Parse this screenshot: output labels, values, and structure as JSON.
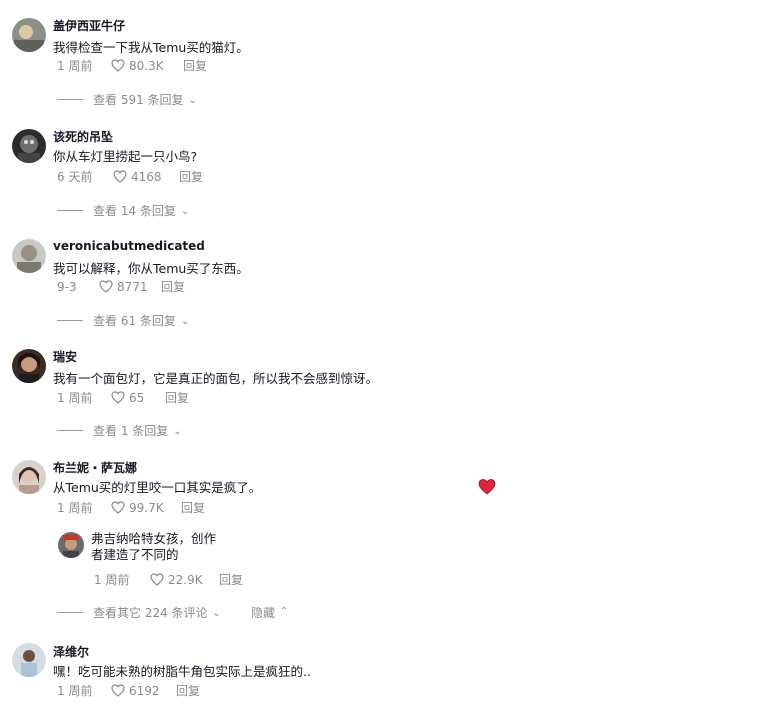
{
  "comments": [
    {
      "username": "盖伊西亚牛仔",
      "text": "我得检查一下我从Temu买的猫灯。",
      "time": "1 周前",
      "likes": "80.3K",
      "reply_label": "回复",
      "view_replies": "查看 591 条回复"
    },
    {
      "username": "该死的吊坠",
      "text": "你从车灯里捞起一只小鸟?",
      "time": "6 天前",
      "likes": "4168",
      "reply_label": "回复",
      "view_replies": "查看 14 条回复"
    },
    {
      "username": "veronicabutmedicated",
      "text": "我可以解释，你从Temu买了东西。",
      "time": "9-3",
      "likes": "8771",
      "reply_label": "回复",
      "view_replies": "查看 61 条回复"
    },
    {
      "username": "瑞安",
      "text": "我有一个面包灯，它是真正的面包，所以我不会感到惊讶。",
      "time": "1 周前",
      "likes": "65",
      "reply_label": "回复",
      "view_replies": "查看 1 条回复"
    },
    {
      "username": "布兰妮・萨瓦娜",
      "text": "从Temu买的灯里咬一口其实是疯了。",
      "time": "1 周前",
      "likes": "99.7K",
      "reply_label": "回复"
    },
    {
      "username": "泽维尔",
      "text": "嘿！吃可能未熟的树脂牛角包实际上是疯狂的..",
      "time": "1 周前",
      "likes": "6192",
      "reply_label": "回复"
    }
  ],
  "reply": {
    "line1": "弗吉纳哈特女孩，创作",
    "line2": "者建造了不同的",
    "time": "1 周前",
    "likes": "22.9K",
    "reply_label": "回复"
  },
  "thread_footer": {
    "view_more": "查看其它 224 条评论",
    "hide": "隐藏"
  },
  "colors": {
    "liked_heart": "#e0263b",
    "muted_text": "#8a8b91"
  },
  "icons": [
    "heart-outline-icon",
    "chevron-down-icon",
    "chevron-up-icon",
    "heart-filled-icon"
  ]
}
